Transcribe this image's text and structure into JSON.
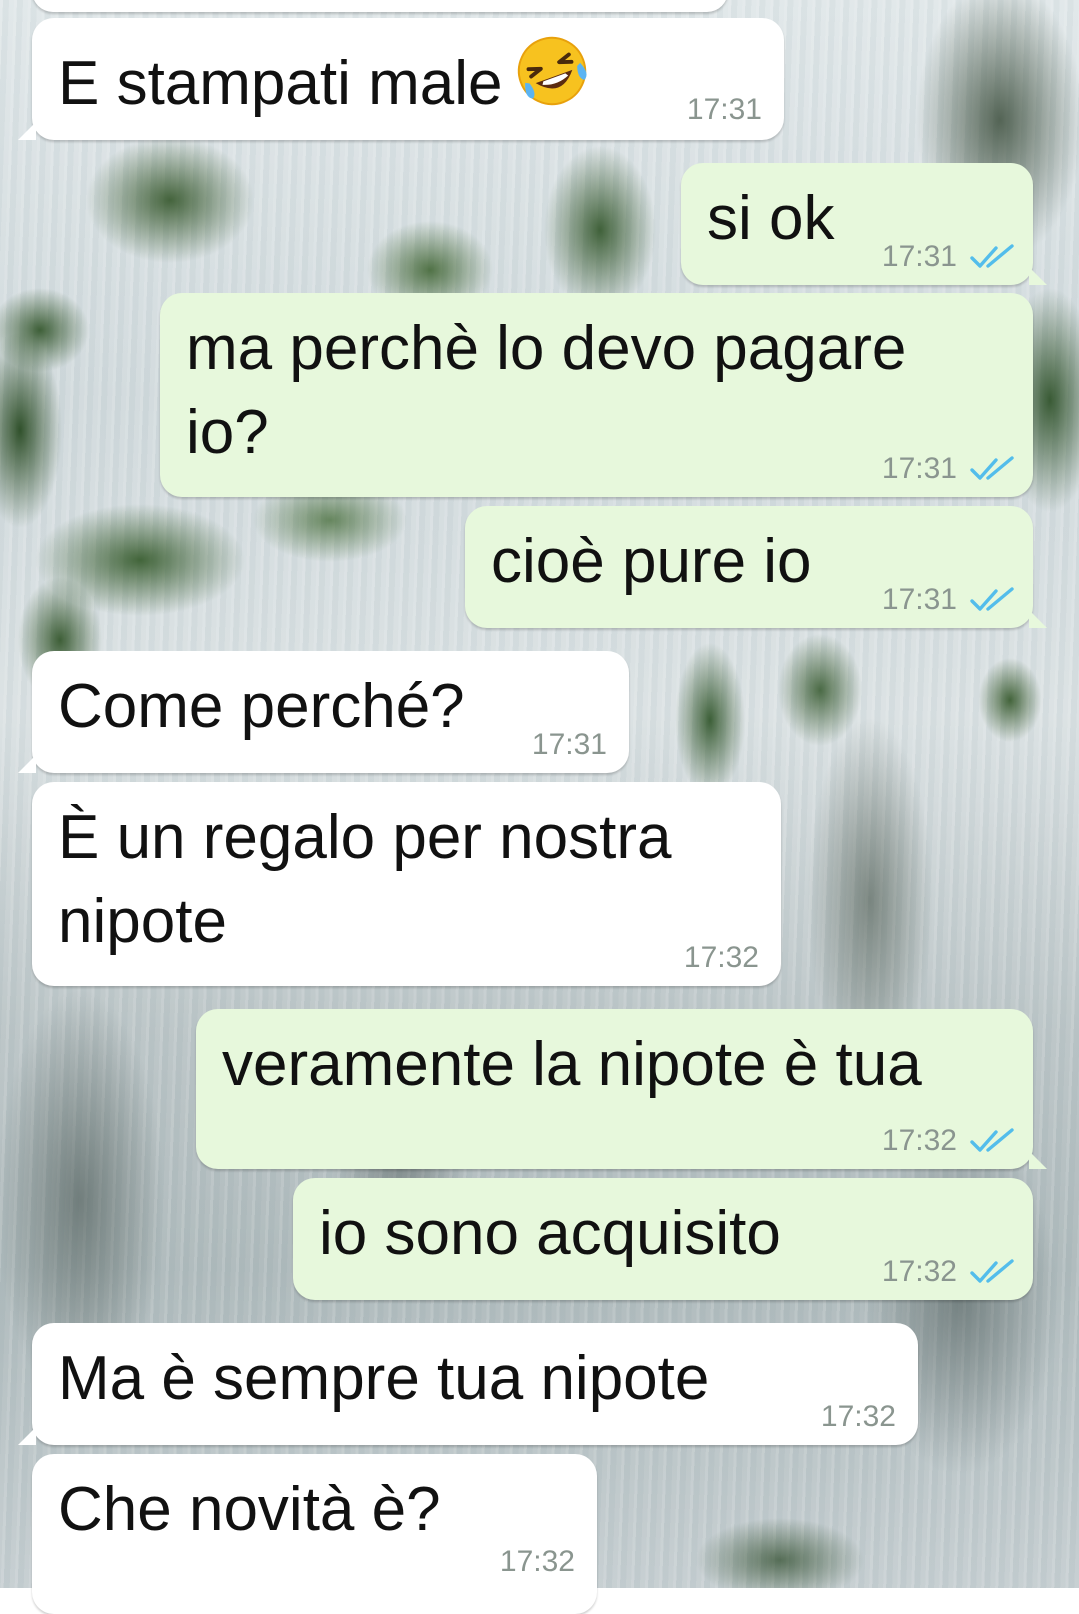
{
  "messages": [
    {
      "direction": "in",
      "text": "E stampati male",
      "emoji": "rolling-on-floor-laughing",
      "time": "17:31"
    },
    {
      "direction": "out",
      "text": "si ok",
      "time": "17:31",
      "status": "read"
    },
    {
      "direction": "out",
      "text": "ma perchè lo devo pagare\nio?",
      "time": "17:31",
      "status": "read"
    },
    {
      "direction": "out",
      "text": "cioè pure io",
      "time": "17:31",
      "status": "read"
    },
    {
      "direction": "in",
      "text": "Come perché?",
      "time": "17:31"
    },
    {
      "direction": "in",
      "text": "È un regalo per nostra\nnipote",
      "time": "17:32"
    },
    {
      "direction": "out",
      "text": "veramente la nipote è tua",
      "time": "17:32",
      "status": "read"
    },
    {
      "direction": "out",
      "text": "io sono acquisito",
      "time": "17:32",
      "status": "read"
    },
    {
      "direction": "in",
      "text": "Ma è sempre tua nipote",
      "time": "17:32"
    },
    {
      "direction": "in",
      "text": "Che novità è?",
      "time": "17:32"
    }
  ],
  "colors": {
    "incoming_bubble": "#ffffff",
    "outgoing_bubble": "#e7f8dc",
    "timestamp": "#8a958f",
    "read_ticks": "#53bdeb"
  }
}
